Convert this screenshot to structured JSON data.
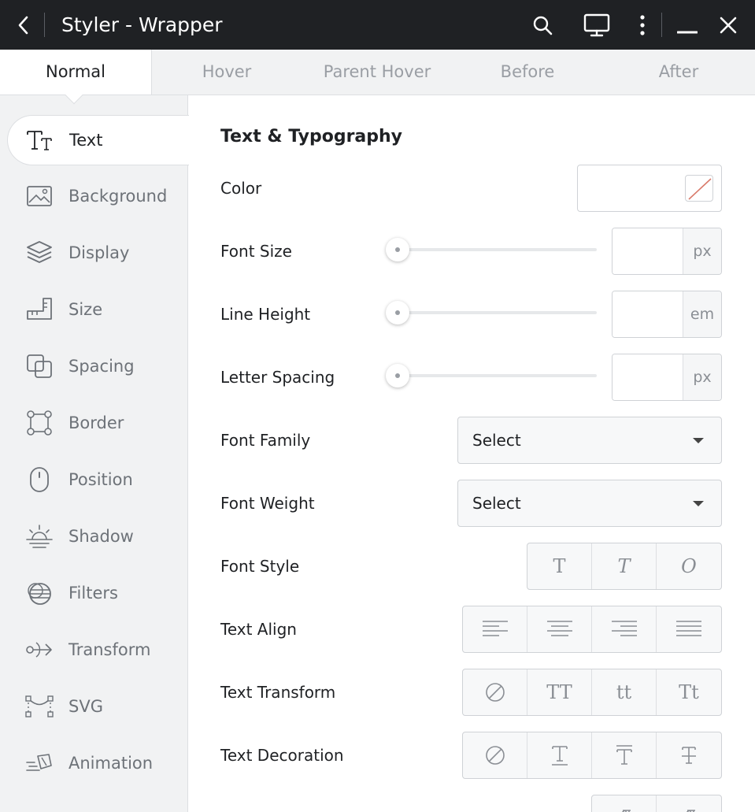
{
  "window": {
    "title": "Styler - Wrapper",
    "icons": [
      "back-icon",
      "search-icon",
      "monitor-icon",
      "more-vertical-icon",
      "minimize-icon",
      "close-icon"
    ]
  },
  "tabs": [
    {
      "label": "Normal",
      "active": true
    },
    {
      "label": "Hover"
    },
    {
      "label": "Parent Hover"
    },
    {
      "label": "Before"
    },
    {
      "label": "After"
    }
  ],
  "sidebar": {
    "items": [
      {
        "label": "Text",
        "icon": "text-icon",
        "active": true
      },
      {
        "label": "Background",
        "icon": "image-icon"
      },
      {
        "label": "Display",
        "icon": "layers-icon"
      },
      {
        "label": "Size",
        "icon": "ruler-icon"
      },
      {
        "label": "Spacing",
        "icon": "spacing-icon"
      },
      {
        "label": "Border",
        "icon": "border-icon"
      },
      {
        "label": "Position",
        "icon": "mouse-icon"
      },
      {
        "label": "Shadow",
        "icon": "sunrise-icon"
      },
      {
        "label": "Filters",
        "icon": "filters-icon"
      },
      {
        "label": "Transform",
        "icon": "transform-icon"
      },
      {
        "label": "SVG",
        "icon": "vector-icon"
      },
      {
        "label": "Animation",
        "icon": "animation-icon"
      }
    ]
  },
  "panel": {
    "section_title": "Text & Typography",
    "color": {
      "label": "Color",
      "value": "none"
    },
    "font_size": {
      "label": "Font Size",
      "unit": "px",
      "value": ""
    },
    "line_height": {
      "label": "Line Height",
      "unit": "em",
      "value": ""
    },
    "letter_spacing": {
      "label": "Letter Spacing",
      "unit": "px",
      "value": ""
    },
    "font_family": {
      "label": "Font Family",
      "value": "Select"
    },
    "font_weight": {
      "label": "Font Weight",
      "value": "Select"
    },
    "font_style": {
      "label": "Font Style",
      "options": [
        "T",
        "T",
        "O"
      ]
    },
    "text_align": {
      "label": "Text Align"
    },
    "text_transform": {
      "label": "Text Transform",
      "options": [
        "TT",
        "tt",
        "Tt"
      ]
    },
    "text_decoration": {
      "label": "Text Decoration"
    }
  },
  "colors": {
    "titlebar": "#1f2124",
    "accent_line": "#d97a6a"
  }
}
